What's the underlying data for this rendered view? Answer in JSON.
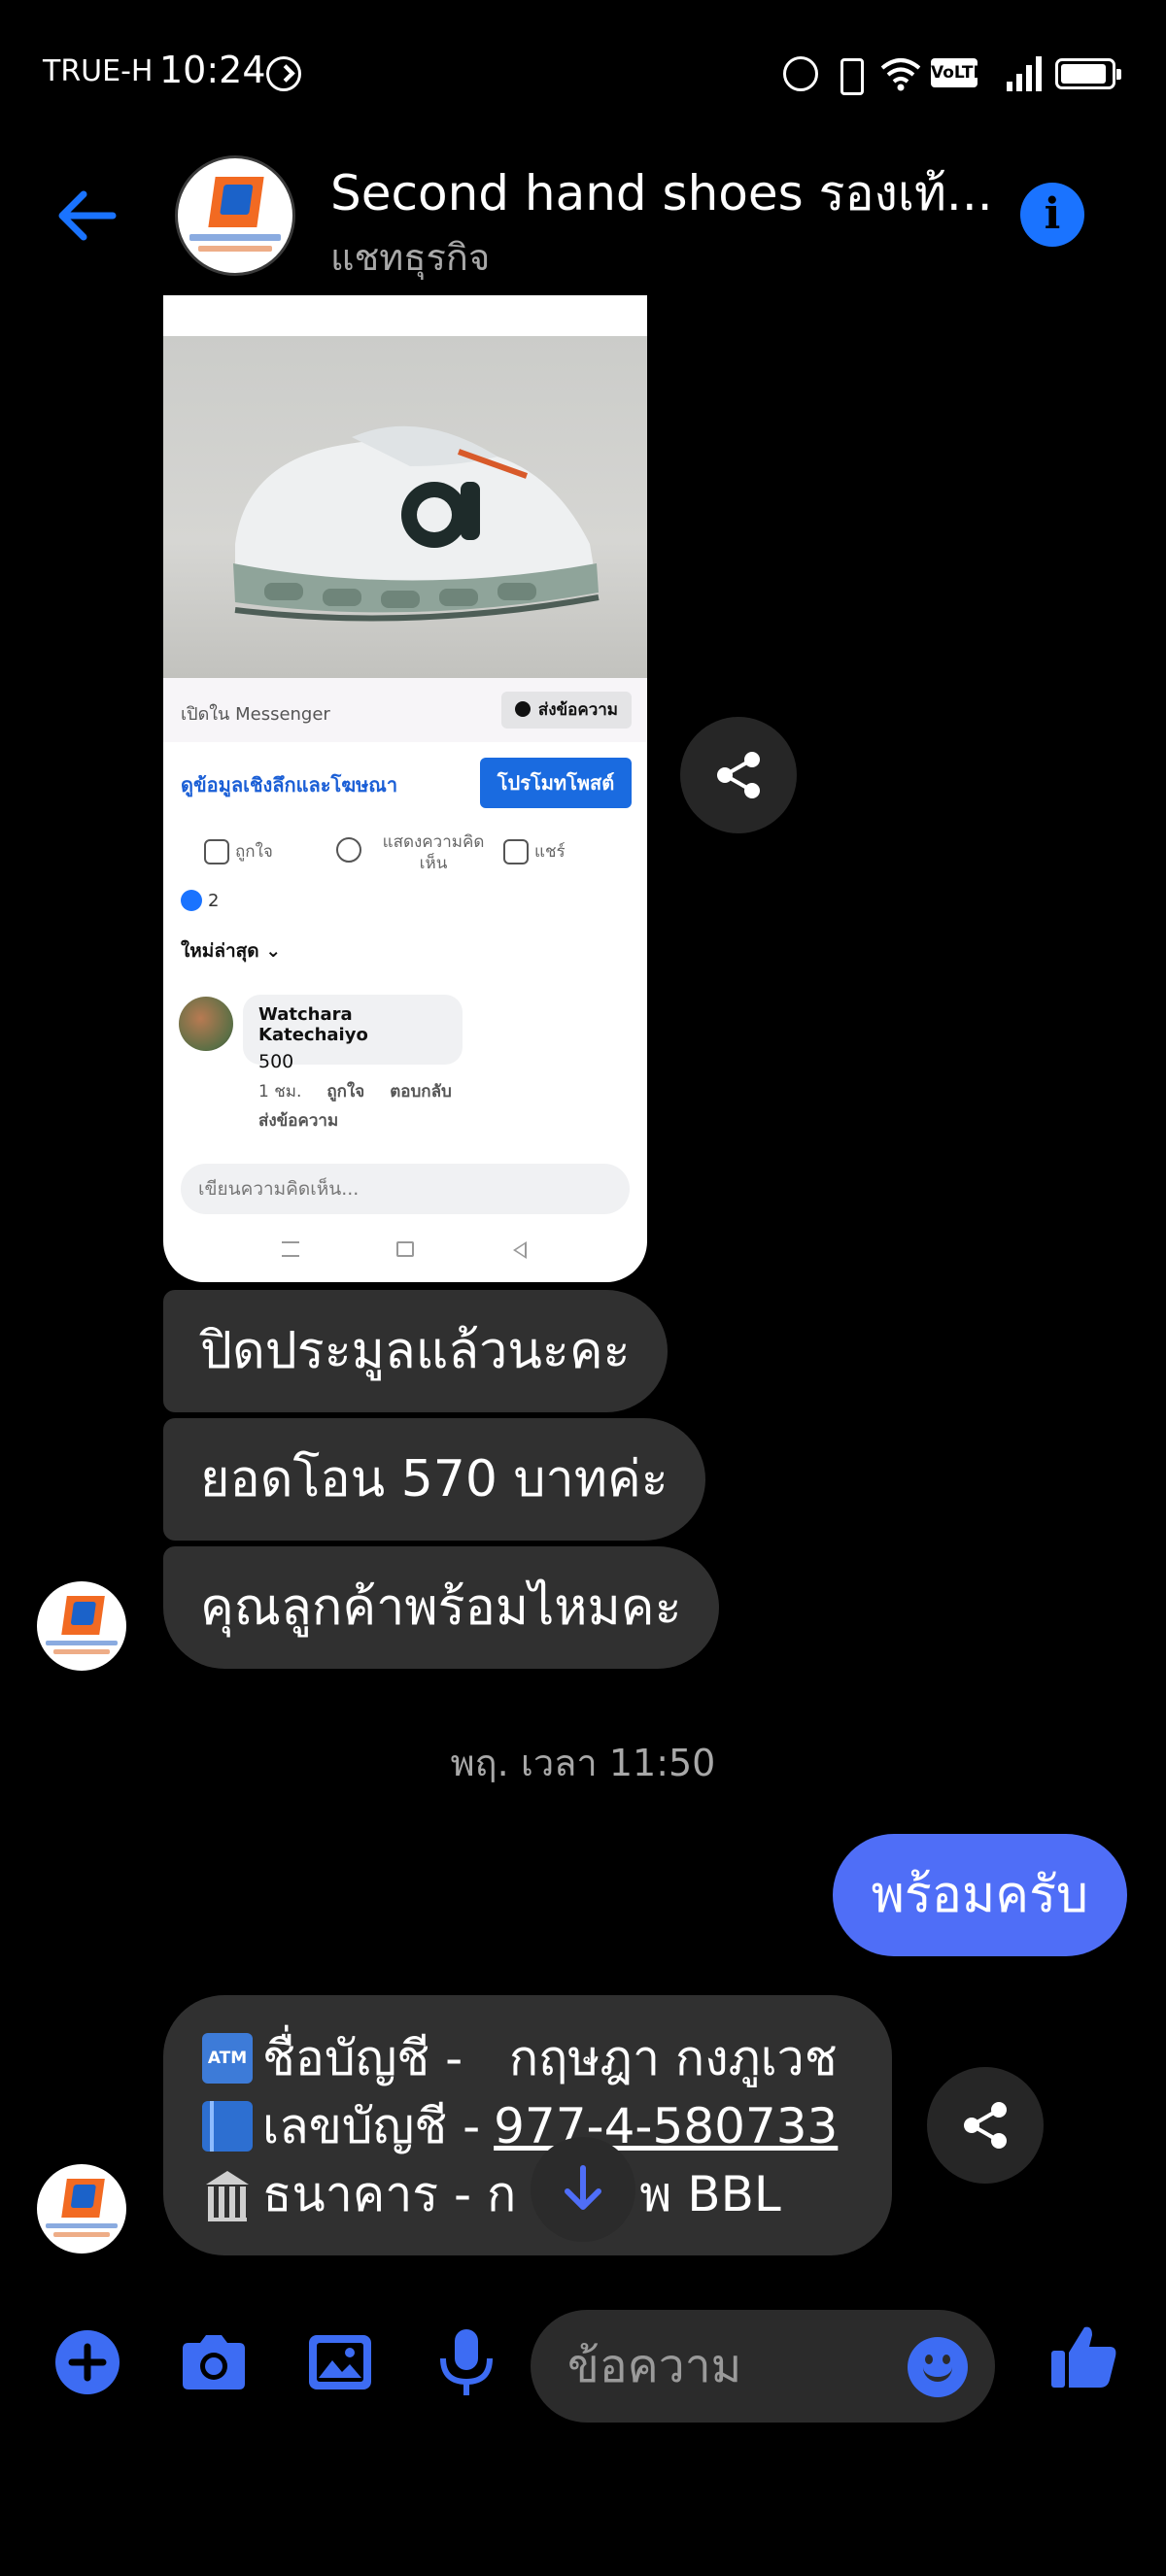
{
  "status_bar": {
    "carrier": "TRUE-H",
    "time": "10:24",
    "network": "VoLTE"
  },
  "header": {
    "title": "Second hand shoes รองเท้...",
    "subtitle": "แชทธุรกิจ"
  },
  "shared_post": {
    "open_in": "เปิดใน Messenger",
    "send_message": "ส่งข้อความ",
    "details_link": "ดูข้อมูลเชิงลึกและโฆษณา",
    "promote": "โปรโมทโพสต์",
    "like": "ถูกใจ",
    "comment": "แสดงความคิดเห็น",
    "share": "แชร์",
    "like_count": "2",
    "sort": "ใหม่ล่าสุด ⌄",
    "comment_author": "Watchara Katechaiyo",
    "comment_text": "500",
    "comment_time": "1 ชม.",
    "comment_like": "ถูกใจ",
    "comment_reply": "ตอบกลับ",
    "comment_send": "ส่งข้อความ",
    "comment_placeholder": "เขียนความคิดเห็น..."
  },
  "messages": {
    "m1": "ปิดประมูลแล้วนะคะ",
    "m2": "ยอดโอน 570 บาทค่ะ",
    "m3": "คุณลูกค้าพร้อมไหมคะ",
    "timestamp": "พฤ. เวลา 11:50",
    "outgoing": "พร้อมครับ",
    "bank": {
      "atm_badge": "ATM",
      "name_label": "ชื่อบัญชี -",
      "name_value": "กฤษฎา กงภูเวช",
      "number_label": "เลขบัญชี -",
      "number_value": "977-4-580733",
      "bank_label": "ธนาคาร  - ก",
      "bank_value": "พ BBL"
    }
  },
  "composer": {
    "placeholder": "ข้อความ"
  },
  "colors": {
    "accent": "#1a73ff",
    "outgoing_bubble": "#4f6ef7",
    "incoming_bubble": "#303030"
  }
}
